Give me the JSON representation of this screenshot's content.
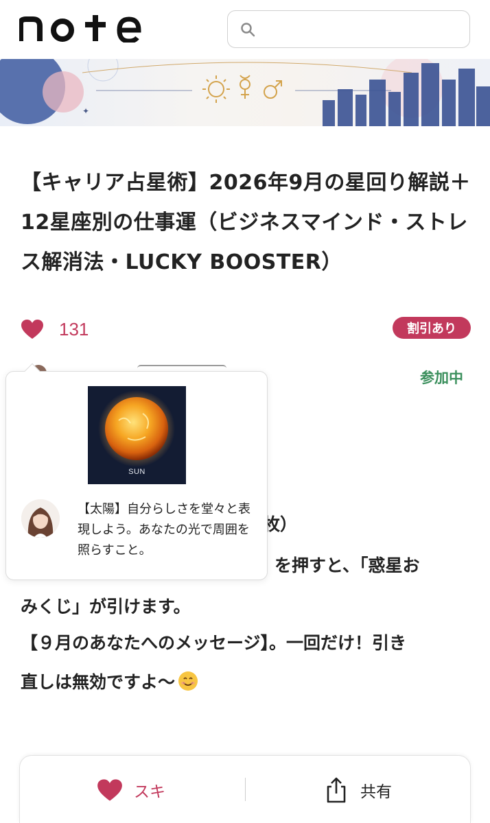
{
  "header": {
    "logo_text": "note",
    "search_placeholder": ""
  },
  "article": {
    "title": "【キャリア占星術】2026年9月の星回り解説＋12星座別の仕事運（ビジネスマインド・ストレス解消法・LUCKY BOOSTER）",
    "like_count": "131",
    "discount_badge": "割引あり",
    "membership_status": "参加中",
    "body_lines": [
      "２枚）",
      "を押すと、「惑星お",
      "みくじ」が引けます。",
      "【９月のあなたへのメッセージ】。一回だけ！引き",
      "直しは無効ですよ〜"
    ]
  },
  "popup": {
    "card_label": "SUN",
    "message": "【太陽】自分らしさを堂々と表現しよう。あなたの光で周囲を照らすこと。"
  },
  "bottom_bar": {
    "like_label": "スキ",
    "share_label": "共有"
  },
  "colors": {
    "accent_pink": "#c2395c",
    "joined_green": "#3a8f5c",
    "text": "#222222"
  },
  "icons": [
    "search-icon",
    "heart-icon",
    "share-icon",
    "smile-emoji-icon",
    "sun-symbol-icon",
    "mercury-symbol-icon",
    "mars-symbol-icon"
  ]
}
